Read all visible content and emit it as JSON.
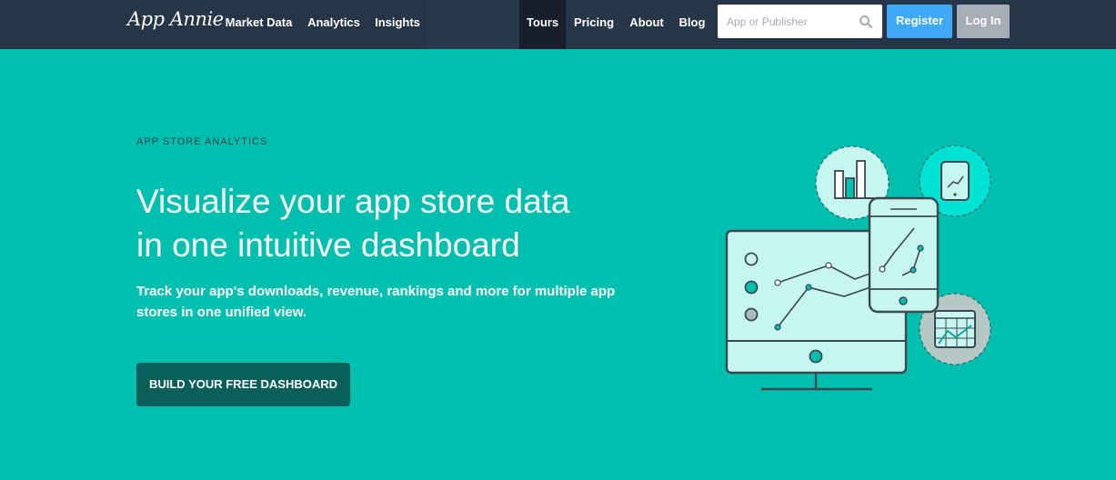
{
  "brand": {
    "logo": "App Annie"
  },
  "nav": {
    "primary": [
      {
        "label": "Market Data"
      },
      {
        "label": "Analytics"
      },
      {
        "label": "Insights"
      }
    ],
    "secondary": [
      {
        "label": "Tours",
        "active": true
      },
      {
        "label": "Pricing"
      },
      {
        "label": "About"
      },
      {
        "label": "Blog"
      }
    ],
    "search": {
      "placeholder": "App or Publisher",
      "value": ""
    },
    "register_label": "Register",
    "login_label": "Log In"
  },
  "hero": {
    "eyebrow": "APP STORE ANALYTICS",
    "headline_line1": "Visualize your app store data",
    "headline_line2": "in one intuitive dashboard",
    "subtext_line1": "Track your app's downloads, revenue, rankings and more for multiple app",
    "subtext_line2": "stores in one unified view.",
    "cta_label": "BUILD YOUR FREE DASHBOARD"
  },
  "illustration": {
    "icons": [
      "bar-chart-icon",
      "tablet-icon",
      "table-chart-icon",
      "desktop-monitor-icon",
      "phone-icon"
    ]
  },
  "colors": {
    "background": "#00bfae",
    "nav_bg": "#263548",
    "nav_active_bg": "#161f2b",
    "register": "#3fa9f5",
    "login": "#a6adb5",
    "cta": "#0a5f5a"
  }
}
